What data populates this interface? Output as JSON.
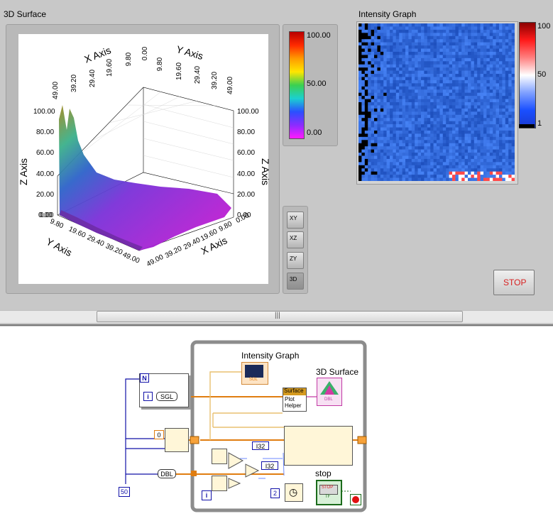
{
  "front_panel": {
    "surface_label": "3D Surface",
    "intensity_label": "Intensity Graph",
    "colorbar_ticks": [
      "100.00",
      "50.00",
      "0.00"
    ],
    "intensity_ticks": [
      "100",
      "50",
      "1"
    ],
    "stop_label": "STOP",
    "surface_axes": {
      "x_axis_top": "X Axis",
      "y_axis_top": "Y Axis",
      "z_axis_left": "Z Axis",
      "z_axis_right": "Z Axis",
      "y_axis_bottom": "Y Axis",
      "x_axis_bottom": "X Axis",
      "xy_ticks": [
        "0.00",
        "9.80",
        "19.60",
        "29.40",
        "39.20",
        "49.00"
      ],
      "z_ticks": [
        "100.00",
        "80.00",
        "60.00",
        "40.00",
        "20.00",
        "0.00"
      ]
    },
    "projection_buttons": [
      "XY",
      "XZ",
      "ZY",
      "3D"
    ],
    "colors": {
      "panel": "#c8c8c8",
      "stop_text": "#d62020",
      "intensity_bg": "#2a5fd8"
    }
  },
  "block_diagram": {
    "intensity_graph_label": "Intensity Graph",
    "surface_label": "3D Surface",
    "surface_helper_title": "Surface",
    "surface_helper_lines": [
      "Plot",
      "Helper"
    ],
    "n_label": "N",
    "i_label": "i",
    "sgl_label": "SGL",
    "dbl_label": "DBL",
    "zero_const": "0",
    "fifty_const": "50",
    "i32_labels": [
      "I32",
      "I32"
    ],
    "two_const": "2",
    "stop_label": "stop",
    "stop_button": "STOP",
    "tf_label": "TF",
    "sgl_small": "SGL",
    "dbl_small": "DBL"
  }
}
